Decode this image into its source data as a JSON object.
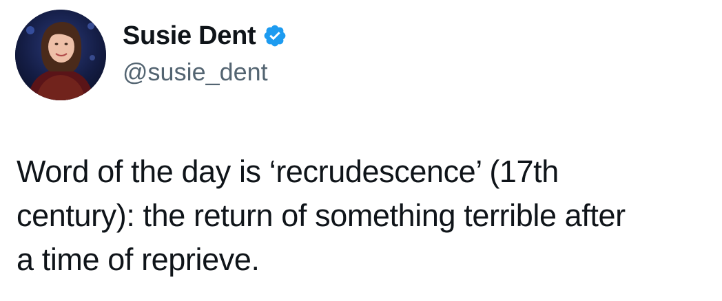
{
  "author": {
    "display_name": "Susie Dent",
    "handle": "@susie_dent",
    "verified": true,
    "verified_icon": "verified-badge-icon",
    "verified_color": "#1d9bf0"
  },
  "tweet": {
    "lines": [
      "Word of the day is ‘recrudescence’ (17th",
      "century): the return of something terrible after",
      "a time of reprieve."
    ]
  }
}
